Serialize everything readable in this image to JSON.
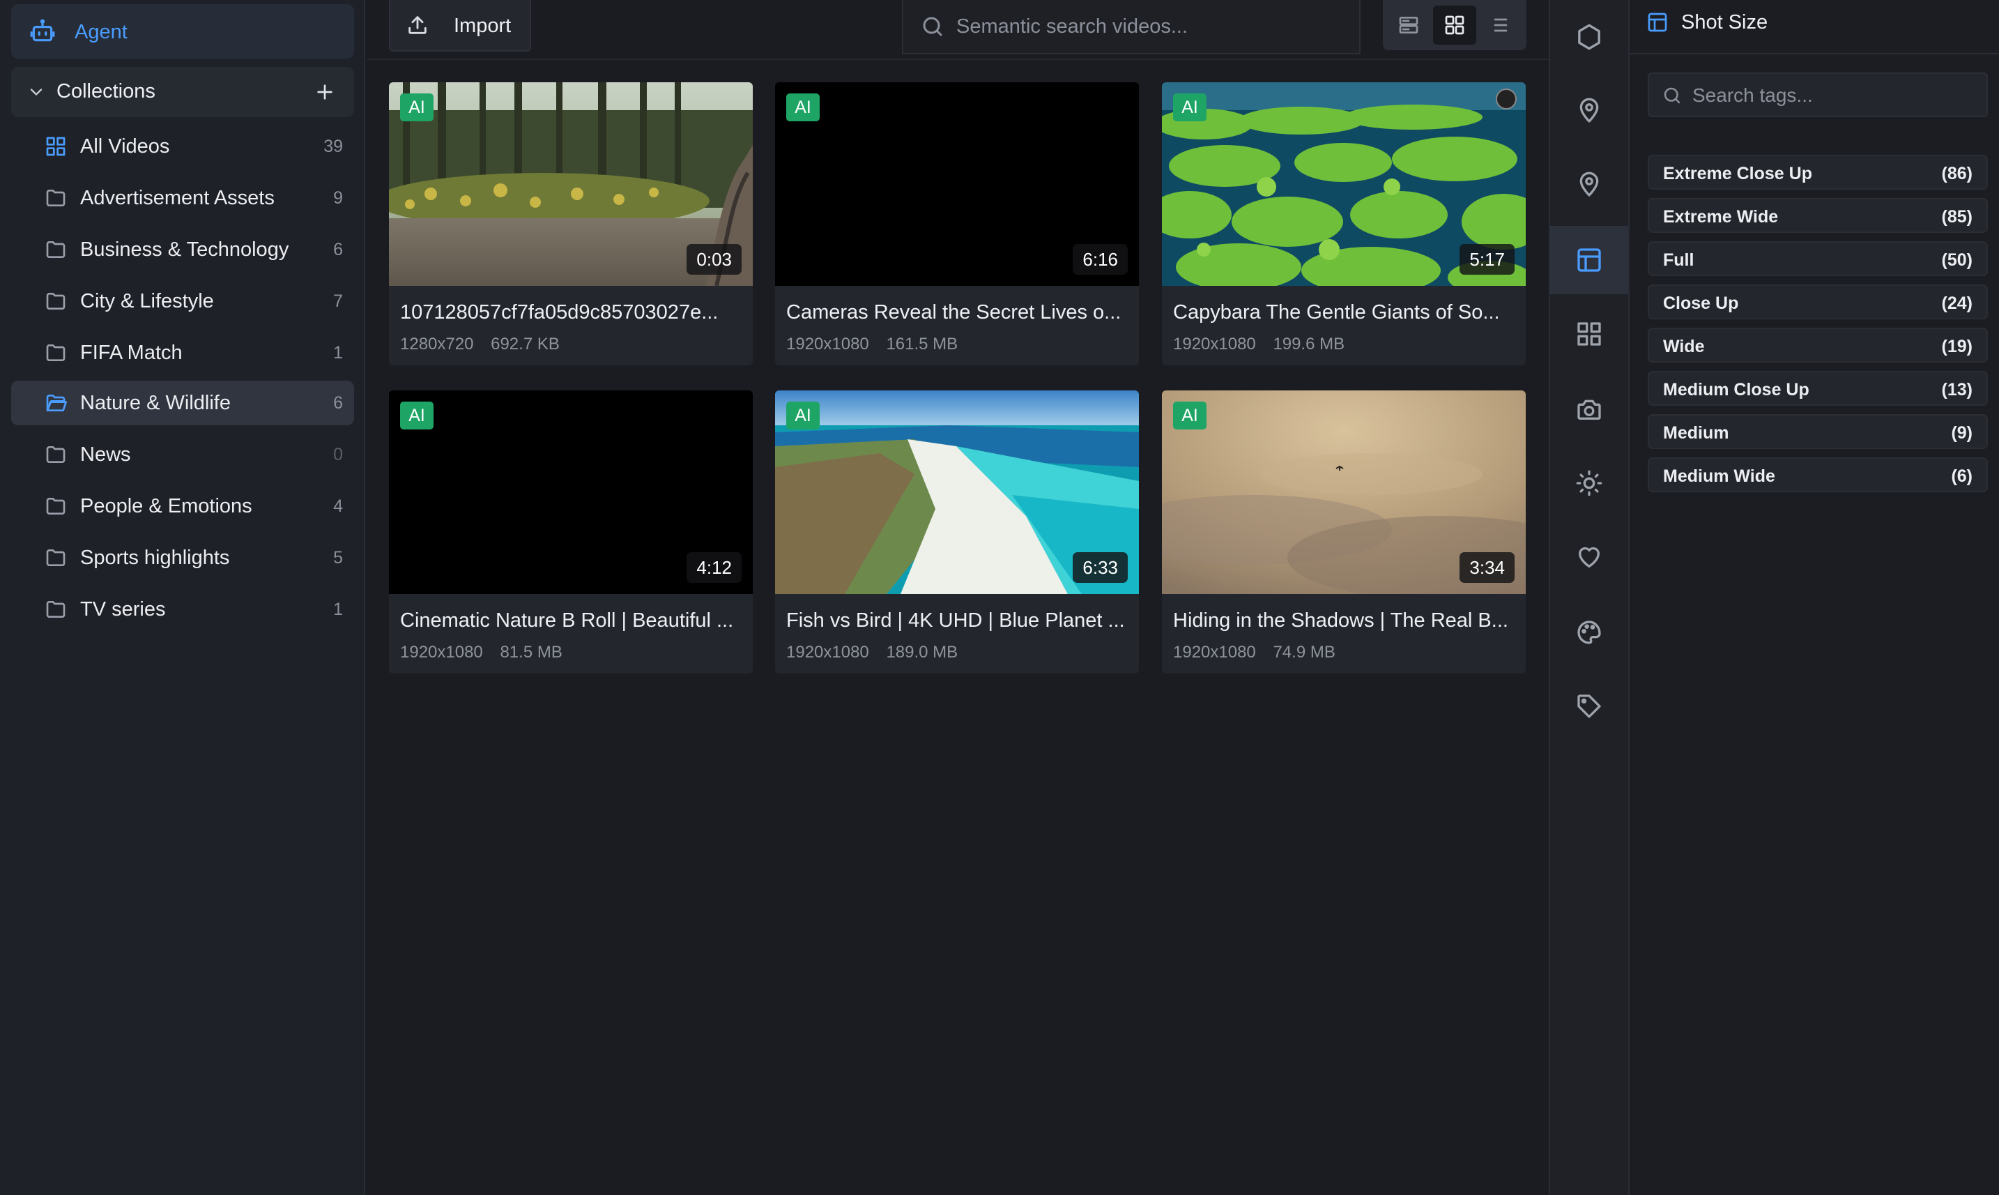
{
  "sidebar": {
    "agent_label": "Agent",
    "collections_label": "Collections",
    "items": [
      {
        "label": "All Videos",
        "count": "39"
      },
      {
        "label": "Advertisement Assets",
        "count": "9"
      },
      {
        "label": "Business & Technology",
        "count": "6"
      },
      {
        "label": "City & Lifestyle",
        "count": "7"
      },
      {
        "label": "FIFA Match",
        "count": "1"
      },
      {
        "label": "Nature & Wildlife",
        "count": "6"
      },
      {
        "label": "News",
        "count": "0"
      },
      {
        "label": "People & Emotions",
        "count": "4"
      },
      {
        "label": "Sports highlights",
        "count": "5"
      },
      {
        "label": "TV series",
        "count": "1"
      }
    ],
    "active_item": "Nature & Wildlife"
  },
  "toolbar": {
    "import_label": "Import",
    "search_placeholder": "Semantic search videos...",
    "view_modes": [
      "rows-view",
      "grid-view",
      "list-view"
    ],
    "active_view": "grid-view"
  },
  "videos": [
    {
      "title": "107128057cf7fa05d9c85703027e...",
      "resolution": "1280x720",
      "size": "692.7 KB",
      "duration": "0:03",
      "badge": "AI"
    },
    {
      "title": "Cameras Reveal the Secret Lives o...",
      "resolution": "1920x1080",
      "size": "161.5 MB",
      "duration": "6:16",
      "badge": "AI"
    },
    {
      "title": "Capybara The Gentle Giants of So...",
      "resolution": "1920x1080",
      "size": "199.6 MB",
      "duration": "5:17",
      "badge": "AI"
    },
    {
      "title": "Cinematic Nature B Roll | Beautiful ...",
      "resolution": "1920x1080",
      "size": "81.5 MB",
      "duration": "4:12",
      "badge": "AI"
    },
    {
      "title": "Fish vs Bird | 4K UHD | Blue Planet ...",
      "resolution": "1920x1080",
      "size": "189.0 MB",
      "duration": "6:33",
      "badge": "AI"
    },
    {
      "title": "Hiding in the Shadows | The Real B...",
      "resolution": "1920x1080",
      "size": "74.9 MB",
      "duration": "3:34",
      "badge": "AI"
    }
  ],
  "rail": {
    "icons": [
      "hexagon-icon",
      "map-pin-icon",
      "location-icon",
      "layout-icon",
      "grid-icon",
      "camera-icon",
      "sun-icon",
      "heart-icon",
      "palette-icon",
      "tag-icon"
    ],
    "active": "layout-icon"
  },
  "tag_panel": {
    "title": "Shot Size",
    "search_placeholder": "Search tags...",
    "tags": [
      {
        "name": "Extreme Close Up",
        "count": "(86)"
      },
      {
        "name": "Extreme Wide",
        "count": "(85)"
      },
      {
        "name": "Full",
        "count": "(50)"
      },
      {
        "name": "Close Up",
        "count": "(24)"
      },
      {
        "name": "Wide",
        "count": "(19)"
      },
      {
        "name": "Medium Close Up",
        "count": "(13)"
      },
      {
        "name": "Medium",
        "count": "(9)"
      },
      {
        "name": "Medium Wide",
        "count": "(6)"
      }
    ]
  },
  "colors": {
    "accent": "#4a9dff",
    "ai_badge": "#1ea565",
    "background": "#1a1c22"
  }
}
